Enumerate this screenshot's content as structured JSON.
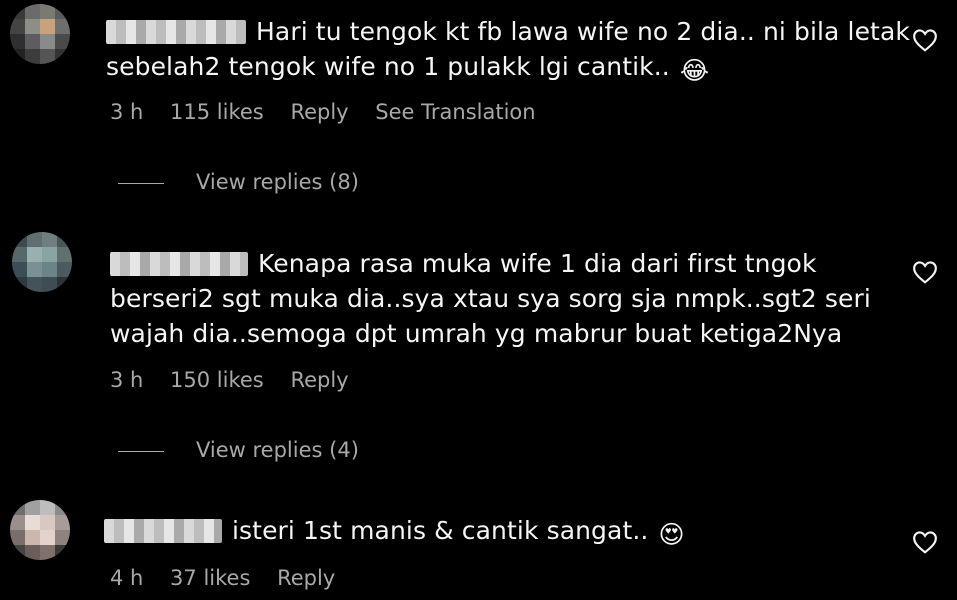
{
  "colors": {
    "background": "#000000",
    "text_primary": "#f5f5f5",
    "text_secondary": "#a8a8a8"
  },
  "comments": [
    {
      "text": "Hari tu tengok kt fb lawa wife no 2 dia.. ni bila letak\nsebelah2 tengok wife no 1 pulakk lgi cantik..",
      "emoji": "😂",
      "time": "3 h",
      "likes": "115 likes",
      "reply_label": "Reply",
      "translate_label": "See Translation",
      "view_replies": "View replies (8)",
      "like_icon": "heart-outline-icon"
    },
    {
      "text": "Kenapa rasa muka wife 1 dia dari first tngok\nberseri2 sgt muka dia..sya xtau sya sorg sja nmpk..sgt2 seri\nwajah dia..semoga dpt umrah yg mabrur buat ketiga2Nya",
      "time": "3 h",
      "likes": "150 likes",
      "reply_label": "Reply",
      "view_replies": "View replies (4)",
      "like_icon": "heart-outline-icon"
    },
    {
      "text": "isteri 1st manis & cantik sangat..",
      "emoji": "😍",
      "time": "4 h",
      "likes": "37 likes",
      "reply_label": "Reply",
      "like_icon": "heart-outline-icon"
    }
  ]
}
